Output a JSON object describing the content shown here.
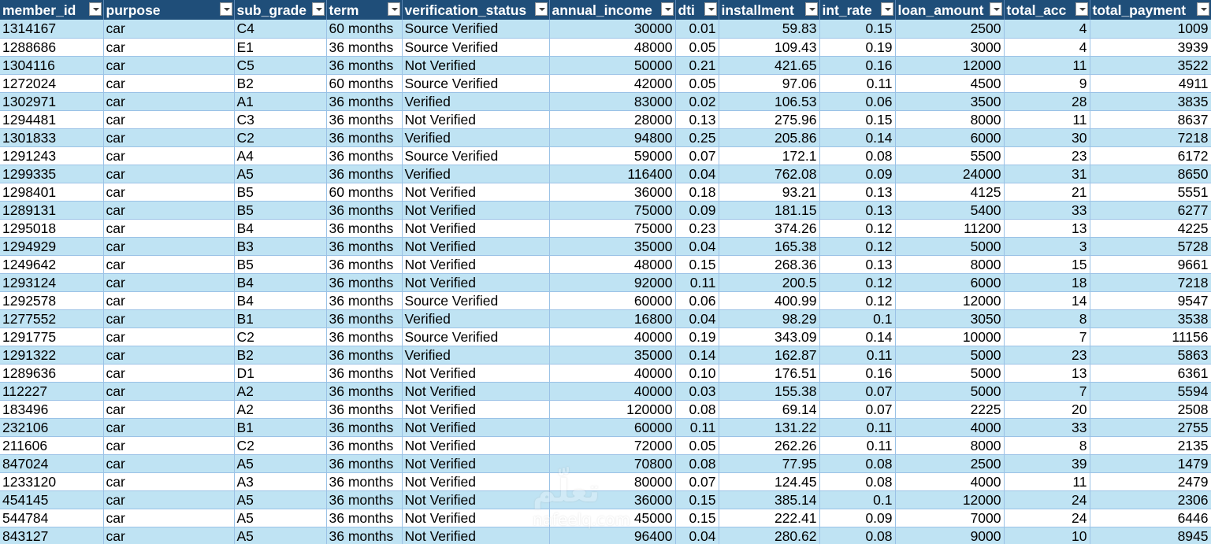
{
  "columns": [
    "member_id",
    "purpose",
    "sub_grade",
    "term",
    "verification_status",
    "annual_income",
    "dti",
    "installment",
    "int_rate",
    "loan_amount",
    "total_acc",
    "total_payment"
  ],
  "rows": [
    [
      "1314167",
      "car",
      "C4",
      "60 months",
      "Source Verified",
      "30000",
      "0.01",
      "59.83",
      "0.15",
      "2500",
      "4",
      "1009"
    ],
    [
      "1288686",
      "car",
      "E1",
      "36 months",
      "Source Verified",
      "48000",
      "0.05",
      "109.43",
      "0.19",
      "3000",
      "4",
      "3939"
    ],
    [
      "1304116",
      "car",
      "C5",
      "36 months",
      "Not Verified",
      "50000",
      "0.21",
      "421.65",
      "0.16",
      "12000",
      "11",
      "3522"
    ],
    [
      "1272024",
      "car",
      "B2",
      "60 months",
      "Source Verified",
      "42000",
      "0.05",
      "97.06",
      "0.11",
      "4500",
      "9",
      "4911"
    ],
    [
      "1302971",
      "car",
      "A1",
      "36 months",
      "Verified",
      "83000",
      "0.02",
      "106.53",
      "0.06",
      "3500",
      "28",
      "3835"
    ],
    [
      "1294481",
      "car",
      "C3",
      "36 months",
      "Not Verified",
      "28000",
      "0.13",
      "275.96",
      "0.15",
      "8000",
      "11",
      "8637"
    ],
    [
      "1301833",
      "car",
      "C2",
      "36 months",
      "Verified",
      "94800",
      "0.25",
      "205.86",
      "0.14",
      "6000",
      "30",
      "7218"
    ],
    [
      "1291243",
      "car",
      "A4",
      "36 months",
      "Source Verified",
      "59000",
      "0.07",
      "172.1",
      "0.08",
      "5500",
      "23",
      "6172"
    ],
    [
      "1299335",
      "car",
      "A5",
      "36 months",
      "Verified",
      "116400",
      "0.04",
      "762.08",
      "0.09",
      "24000",
      "31",
      "8650"
    ],
    [
      "1298401",
      "car",
      "B5",
      "60 months",
      "Not Verified",
      "36000",
      "0.18",
      "93.21",
      "0.13",
      "4125",
      "21",
      "5551"
    ],
    [
      "1289131",
      "car",
      "B5",
      "36 months",
      "Not Verified",
      "75000",
      "0.09",
      "181.15",
      "0.13",
      "5400",
      "33",
      "6277"
    ],
    [
      "1295018",
      "car",
      "B4",
      "36 months",
      "Not Verified",
      "75000",
      "0.23",
      "374.26",
      "0.12",
      "11200",
      "13",
      "4225"
    ],
    [
      "1294929",
      "car",
      "B3",
      "36 months",
      "Not Verified",
      "35000",
      "0.04",
      "165.38",
      "0.12",
      "5000",
      "3",
      "5728"
    ],
    [
      "1249642",
      "car",
      "B5",
      "36 months",
      "Not Verified",
      "48000",
      "0.15",
      "268.36",
      "0.13",
      "8000",
      "15",
      "9661"
    ],
    [
      "1293124",
      "car",
      "B4",
      "36 months",
      "Not Verified",
      "92000",
      "0.11",
      "200.5",
      "0.12",
      "6000",
      "18",
      "7218"
    ],
    [
      "1292578",
      "car",
      "B4",
      "36 months",
      "Source Verified",
      "60000",
      "0.06",
      "400.99",
      "0.12",
      "12000",
      "14",
      "9547"
    ],
    [
      "1277552",
      "car",
      "B1",
      "36 months",
      "Verified",
      "16800",
      "0.04",
      "98.29",
      "0.1",
      "3050",
      "8",
      "3538"
    ],
    [
      "1291775",
      "car",
      "C2",
      "36 months",
      "Source Verified",
      "40000",
      "0.19",
      "343.09",
      "0.14",
      "10000",
      "7",
      "11156"
    ],
    [
      "1291322",
      "car",
      "B2",
      "36 months",
      "Verified",
      "35000",
      "0.14",
      "162.87",
      "0.11",
      "5000",
      "23",
      "5863"
    ],
    [
      "1289636",
      "car",
      "D1",
      "36 months",
      "Not Verified",
      "40000",
      "0.10",
      "176.51",
      "0.16",
      "5000",
      "13",
      "6361"
    ],
    [
      "112227",
      "car",
      "A2",
      "36 months",
      "Not Verified",
      "40000",
      "0.03",
      "155.38",
      "0.07",
      "5000",
      "7",
      "5594"
    ],
    [
      "183496",
      "car",
      "A2",
      "36 months",
      "Not Verified",
      "120000",
      "0.08",
      "69.14",
      "0.07",
      "2225",
      "20",
      "2508"
    ],
    [
      "232106",
      "car",
      "B1",
      "36 months",
      "Not Verified",
      "60000",
      "0.11",
      "131.22",
      "0.11",
      "4000",
      "33",
      "2755"
    ],
    [
      "211606",
      "car",
      "C2",
      "36 months",
      "Not Verified",
      "72000",
      "0.05",
      "262.26",
      "0.11",
      "8000",
      "8",
      "2135"
    ],
    [
      "847024",
      "car",
      "A5",
      "36 months",
      "Not Verified",
      "70800",
      "0.08",
      "77.95",
      "0.08",
      "2500",
      "39",
      "1479"
    ],
    [
      "1233120",
      "car",
      "A3",
      "36 months",
      "Not Verified",
      "80000",
      "0.07",
      "124.45",
      "0.08",
      "4000",
      "11",
      "2479"
    ],
    [
      "454145",
      "car",
      "A5",
      "36 months",
      "Not Verified",
      "36000",
      "0.15",
      "385.14",
      "0.1",
      "12000",
      "24",
      "2306"
    ],
    [
      "544784",
      "car",
      "A5",
      "36 months",
      "Not Verified",
      "45000",
      "0.15",
      "222.41",
      "0.09",
      "7000",
      "24",
      "6446"
    ],
    [
      "843127",
      "car",
      "A5",
      "36 months",
      "Not Verified",
      "96400",
      "0.04",
      "280.62",
      "0.08",
      "9000",
      "10",
      "8945"
    ]
  ],
  "numeric_columns": [
    5,
    6,
    7,
    8,
    9,
    10,
    11
  ],
  "watermark": {
    "logo": "تعلّم",
    "sub": "nafeelq.com"
  },
  "colors": {
    "header_bg": "#1f4e79",
    "header_text": "#ffffff",
    "band_row": "#bfe3f3",
    "plain_row": "#ffffff",
    "grid_line": "#9bc2e6"
  }
}
